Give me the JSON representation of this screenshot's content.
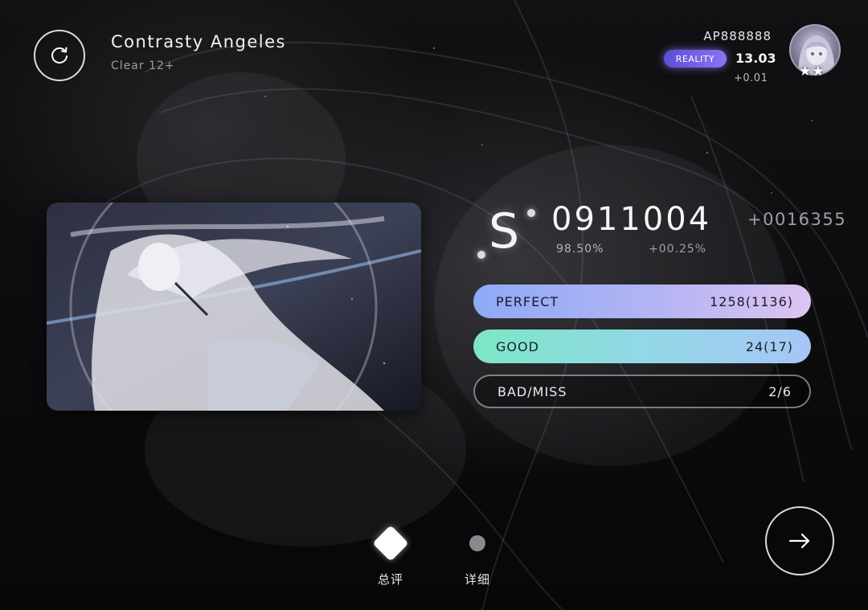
{
  "song": {
    "title": "Contrasty Angeles",
    "difficulty": "Clear 12+"
  },
  "player": {
    "name": "AP888888",
    "badge": "REALITY",
    "rks": "13.03",
    "rks_delta": "+0.01",
    "stars": "★★"
  },
  "result": {
    "rank": "S",
    "score": "0911004",
    "score_delta": "+0016355",
    "accuracy": "98.50%",
    "accuracy_delta": "+00.25%"
  },
  "judgements": [
    {
      "label": "PERFECT",
      "value": "1258(1136)"
    },
    {
      "label": "GOOD",
      "value": "24(17)"
    },
    {
      "label": "BAD/MISS",
      "value": "2/6"
    }
  ],
  "nav": {
    "tab_summary": "总评",
    "tab_detail": "详细"
  },
  "icons": {
    "retry": "retry-icon",
    "next": "arrow-right-icon",
    "summary_indicator": "diamond-icon",
    "detail_indicator": "dot-icon"
  },
  "colors": {
    "perfect_gradient": [
      "#8eaaf6",
      "#ddc4f2"
    ],
    "good_gradient": [
      "#7de6c6",
      "#a6c6f6"
    ],
    "reality_badge": "#6e5fe2"
  }
}
